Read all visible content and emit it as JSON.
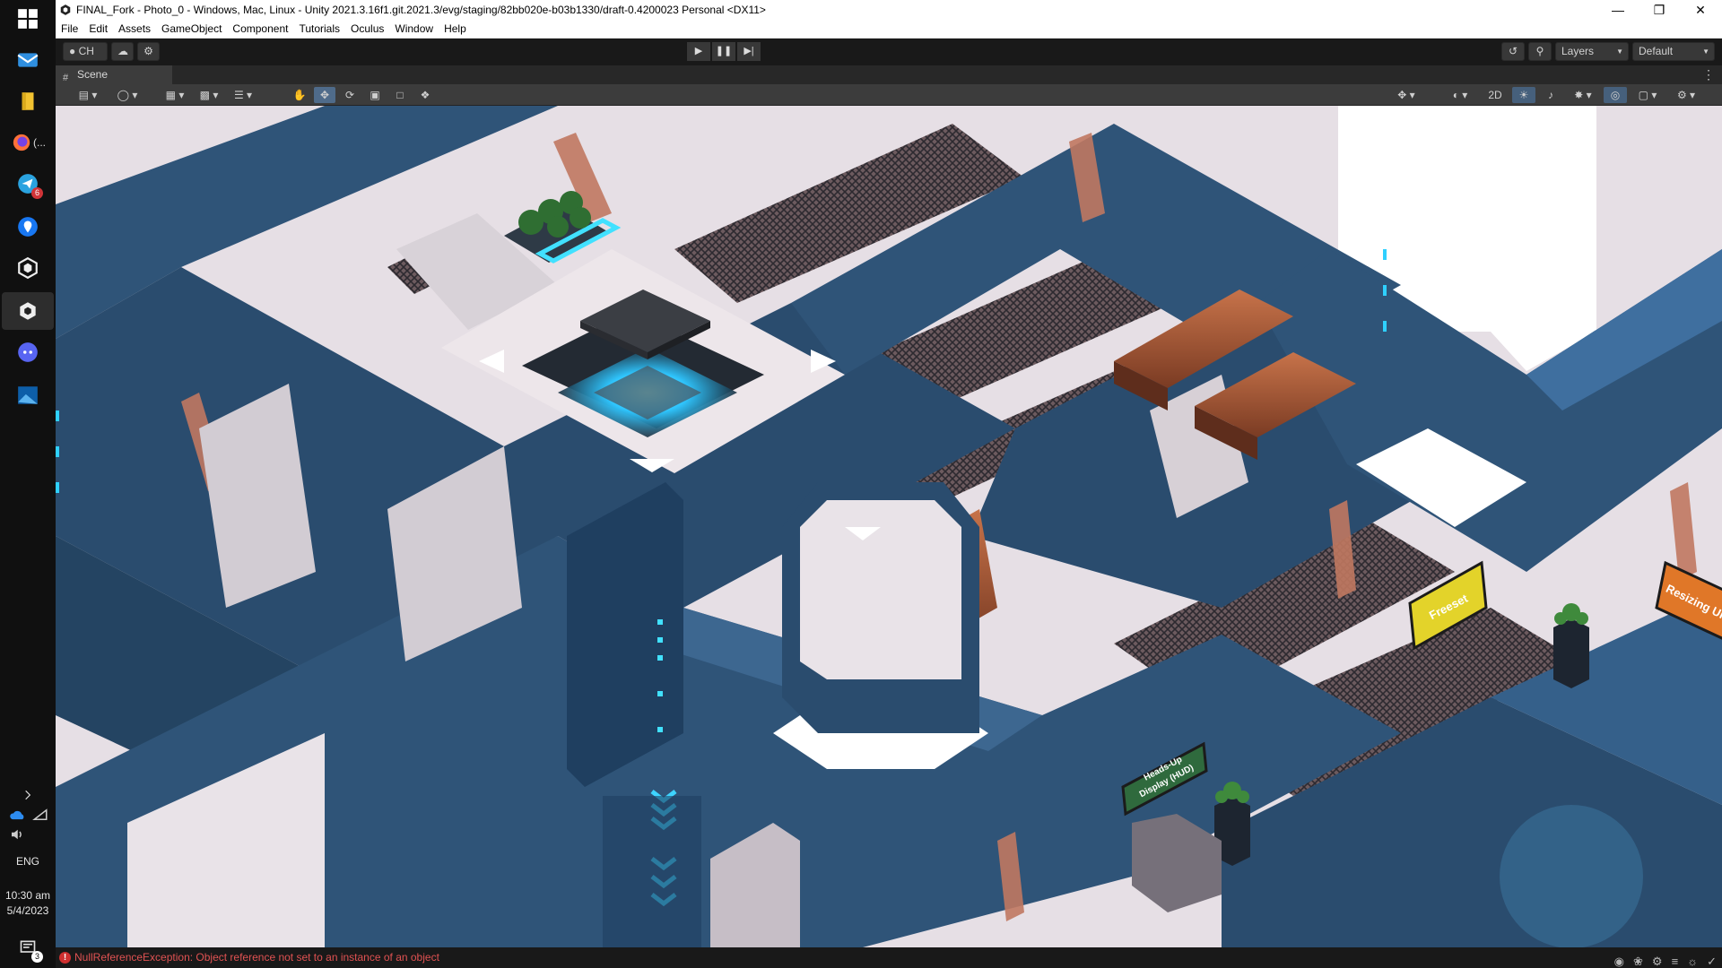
{
  "window": {
    "title": "FINAL_Fork - Photo_0 - Windows, Mac, Linux - Unity 2021.3.16f1.git.2021.3/evg/staging/82bb020e-b03b1330/draft-0.4200023 Personal <DX11>"
  },
  "menu": [
    "File",
    "Edit",
    "Assets",
    "GameObject",
    "Component",
    "Tutorials",
    "Oculus",
    "Window",
    "Help"
  ],
  "toolbar": {
    "account_label": "CH",
    "layers_label": "Layers",
    "layout_label": "Default"
  },
  "scene": {
    "tab_label": "Scene",
    "view_2d_label": "2D",
    "signs": {
      "freeset": "Freeset",
      "resizing_ui": "Resizing UI",
      "hud_line1": "Heads-Up",
      "hud_line2": "Display (HUD)"
    }
  },
  "status": {
    "error_message": "NullReferenceException: Object reference not set to an instance of an object"
  },
  "taskbar": {
    "firefox_label": "(...",
    "telegram_badge": "6",
    "language": "ENG",
    "time": "10:30 am",
    "date": "5/4/2023",
    "notification_badge": "3"
  },
  "colors": {
    "accent_blue": "#3f6f9f",
    "floor": "#e8e1e6",
    "hull": "#2f5478",
    "glow": "#2fc6ff",
    "error": "#e05252"
  }
}
